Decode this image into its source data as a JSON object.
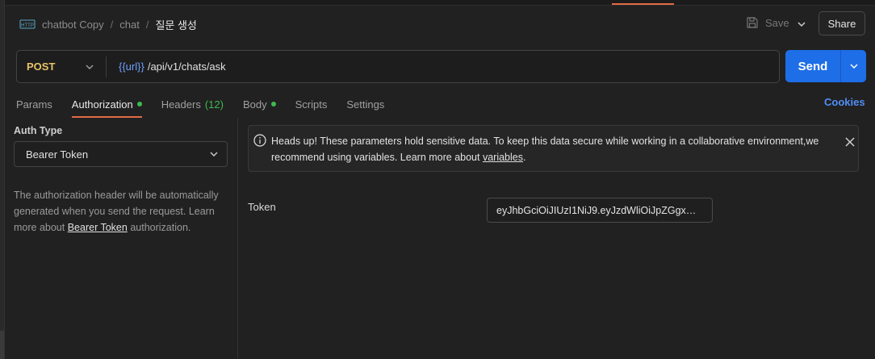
{
  "breadcrumb": {
    "items": [
      "chatbot Copy",
      "chat"
    ],
    "separator": "/",
    "current": "질문 생성"
  },
  "toolbar": {
    "save_label": "Save",
    "share_label": "Share"
  },
  "request": {
    "method": "POST",
    "url_variable": "{{url}}",
    "url_path": "/api/v1/chats/ask",
    "send_label": "Send"
  },
  "tabs": {
    "params": "Params",
    "authorization": "Authorization",
    "headers": "Headers",
    "headers_count": "(12)",
    "body": "Body",
    "scripts": "Scripts",
    "settings": "Settings",
    "cookies": "Cookies"
  },
  "auth": {
    "type_label": "Auth Type",
    "type_value": "Bearer Token",
    "description_prefix": "The authorization header will be automatically generated when you send the request. Learn more about ",
    "description_link": "Bearer Token",
    "description_suffix": " authorization."
  },
  "banner": {
    "text_prefix": "Heads up! These parameters hold sensitive data. To keep this data secure while working in a collaborative environment,we recommend using variables. Learn more about ",
    "link": "variables",
    "text_suffix": "."
  },
  "token": {
    "label": "Token",
    "value": "eyJhbGciOiJIUzI1NiJ9.eyJzdWliOiJpZGgxMl..."
  },
  "colors": {
    "accent_orange": "#e06b44",
    "send_blue": "#1e6ee8",
    "active_dot": "#3fb950",
    "method_yellow": "#e8c268",
    "link_blue": "#4f8ff7"
  }
}
